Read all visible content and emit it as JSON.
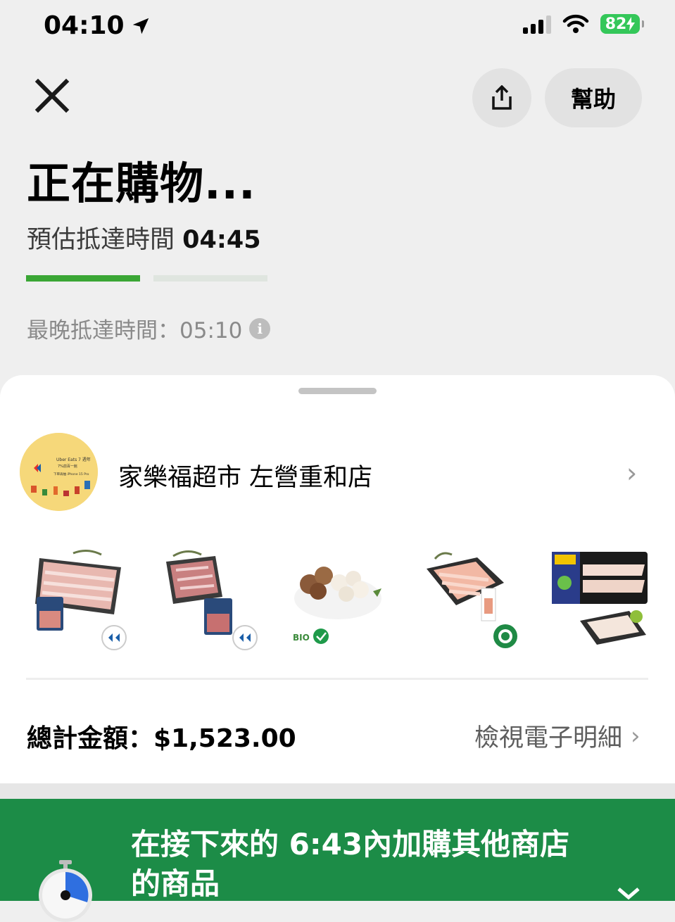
{
  "status_bar": {
    "time": "04:10",
    "battery": "82"
  },
  "header": {
    "help_label": "幫助"
  },
  "order": {
    "title": "正在購物...",
    "eta_label": "預估抵達時間",
    "eta_time": "04:45",
    "latest_arrival": "最晚抵達時間：05:10",
    "progress": [
      1.0,
      0.0
    ]
  },
  "store": {
    "name": "家樂福超市 左營重和店",
    "logo_text": [
      "Uber Eats 7 週年",
      "7%前百一館",
      "下單再抽 iPhone 15 Pro"
    ]
  },
  "items": [
    {
      "icon": "pork-slices-icon"
    },
    {
      "icon": "pork-shoulder-icon"
    },
    {
      "icon": "mushrooms-icon"
    },
    {
      "icon": "chicken-breast-icon"
    },
    {
      "icon": "milkfish-fillet-icon"
    }
  ],
  "summary": {
    "total_label": "總計金額：",
    "total_value": "$1,523.00",
    "receipt_label": "檢視電子明細"
  },
  "banner": {
    "text": "在接下來的 6:43內加購其他商店的商品",
    "color": "#1c8c47"
  },
  "colors": {
    "accent_green": "#3aa635",
    "banner_green": "#1c8c47"
  }
}
